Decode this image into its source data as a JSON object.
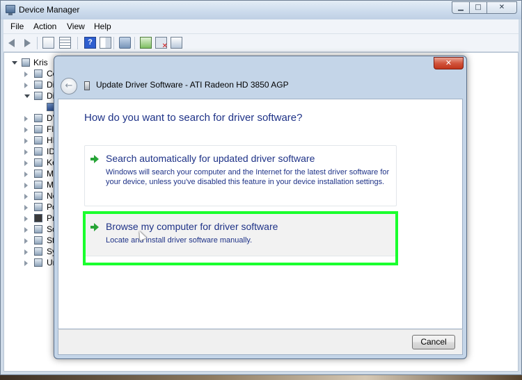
{
  "window": {
    "title": "Device Manager",
    "caption": {
      "minimize": "▁",
      "maximize": "□",
      "close": "✕"
    }
  },
  "menu": {
    "file": "File",
    "action": "Action",
    "view": "View",
    "help": "Help"
  },
  "toolbar": {
    "help_glyph": "?"
  },
  "tree": {
    "root": "Kris",
    "items": [
      "Co",
      "Di",
      "Di",
      "",
      "DV",
      "Flo",
      "HI",
      "ID",
      "Ke",
      "Mi",
      "Mo",
      "Ne",
      "Po",
      "Pro",
      "So",
      "Sto",
      "Sys",
      "Ur"
    ]
  },
  "wizard": {
    "close_glyph": "✕",
    "back_glyph": "←",
    "title": "Update Driver Software - ATI Radeon HD 3850 AGP",
    "question": "How do you want to search for driver software?",
    "options": [
      {
        "title": "Search automatically for updated driver software",
        "description": "Windows will search your computer and the Internet for the latest driver software for your device, unless you've disabled this feature in your device installation settings."
      },
      {
        "title": "Browse my computer for driver software",
        "description": "Locate and install driver software manually."
      }
    ],
    "cancel_label": "Cancel"
  }
}
